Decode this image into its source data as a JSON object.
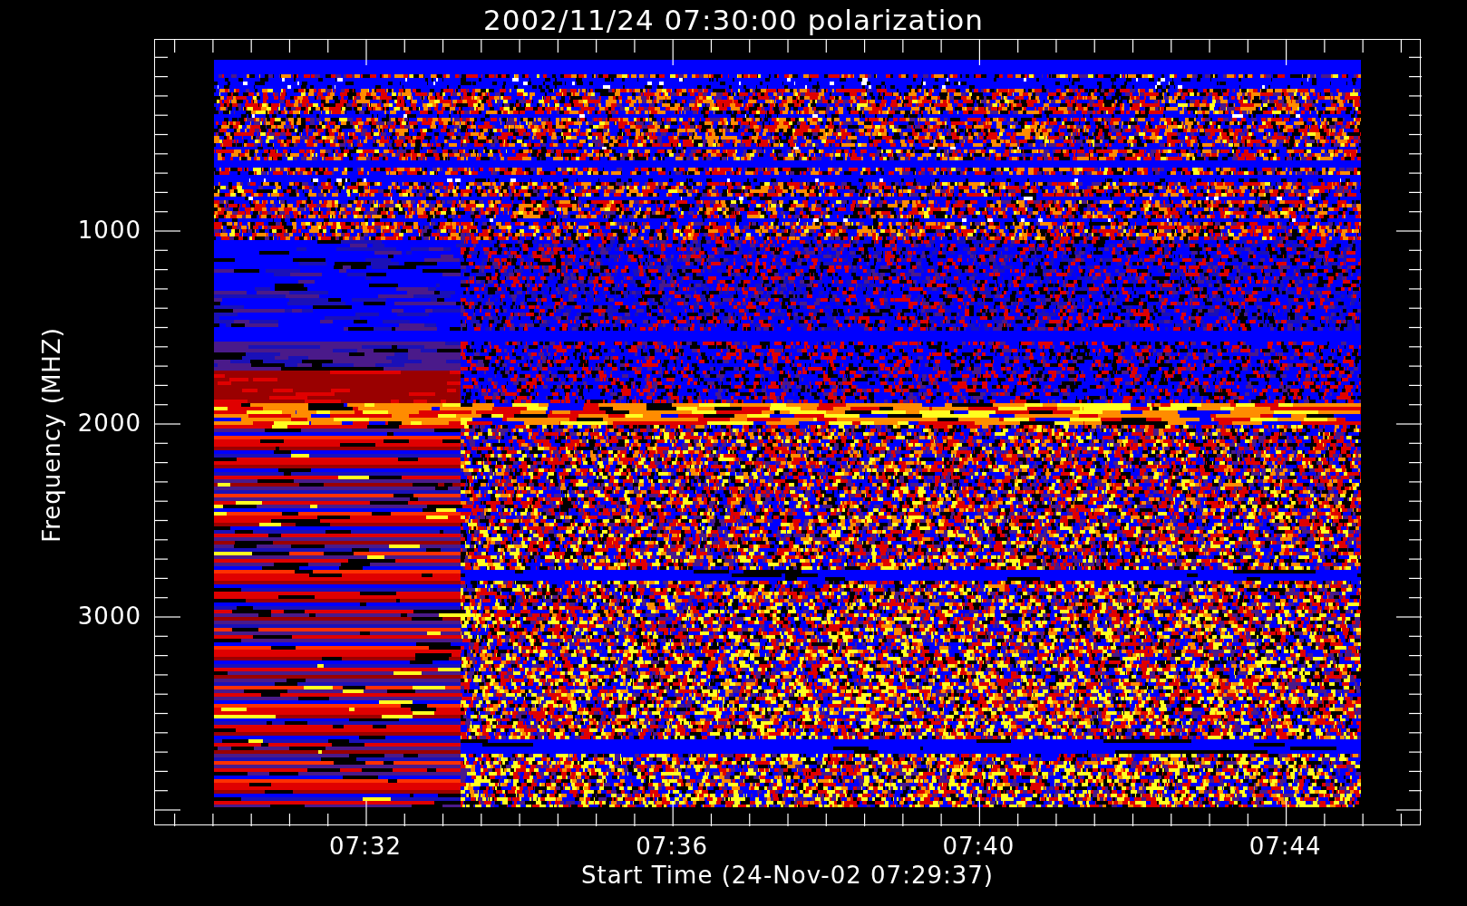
{
  "title": "2002/11/24 07:30:00 polarization",
  "y_axis": {
    "label": "Frequency (MHZ)",
    "tick_labels": [
      "1000",
      "2000",
      "3000"
    ]
  },
  "x_axis": {
    "label": "Start Time (24-Nov-02 07:29:37)",
    "tick_labels": [
      "07:32",
      "07:36",
      "07:40",
      "07:44"
    ]
  }
}
